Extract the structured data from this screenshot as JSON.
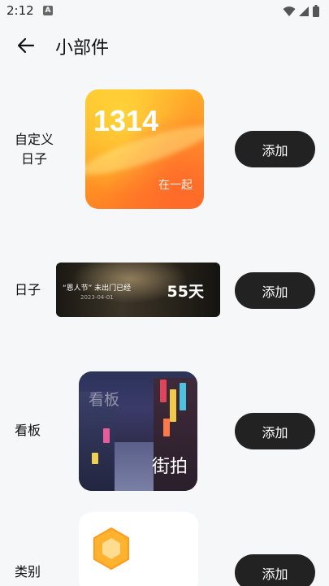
{
  "status_bar": {
    "time": "2:12",
    "notification_letter": "A",
    "icons": [
      "wifi-icon",
      "signal-icon",
      "battery-icon"
    ]
  },
  "header": {
    "back_icon": "arrow-left-icon",
    "title": "小部件"
  },
  "widgets": [
    {
      "label": "自定义\n日子",
      "button": "添加",
      "preview": {
        "number": "1314",
        "caption": "在一起"
      }
    },
    {
      "label": "日子",
      "button": "添加",
      "preview": {
        "title": "“恩人节” 未出门已经",
        "date": "2023-04-01",
        "count": "55天"
      }
    },
    {
      "label": "看板",
      "button": "添加",
      "preview": {
        "watermark": "看板",
        "caption": "街拍"
      }
    },
    {
      "label": "类别",
      "button": "添加",
      "preview": {
        "icon": "hexagon-icon"
      }
    }
  ],
  "colors": {
    "background": "#f6f7f9",
    "button_bg": "#222222",
    "button_text": "#ffffff",
    "hex_orange": "#ffb22e"
  }
}
